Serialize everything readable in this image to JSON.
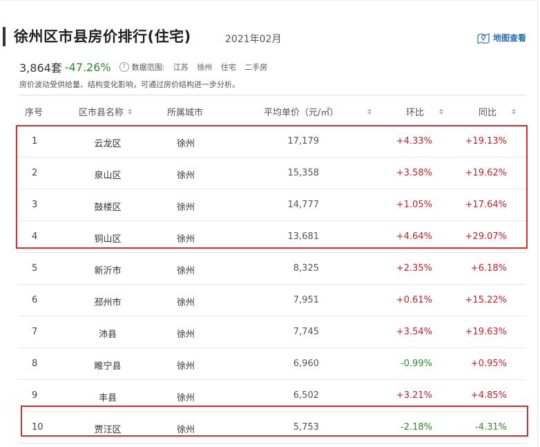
{
  "header": {
    "title": "徐州区市县房价排行(住宅)",
    "date": "2021年02月",
    "map_link": "地图查看"
  },
  "summary": {
    "count": "3,864套",
    "change": "-47.26%",
    "scope_label": "数据范围:",
    "scope_items": [
      "江苏",
      "徐州",
      "住宅",
      "二手房"
    ],
    "note": "房价波动受供给量、结构变化影响，可通过房价结构进一步分析。"
  },
  "table": {
    "columns": [
      "序号",
      "区市县名称",
      "所属城市",
      "平均单价（元/㎡）",
      "环比",
      "同比"
    ],
    "rows": [
      {
        "idx": "1",
        "name": "云龙区",
        "city": "徐州",
        "price": "17,179",
        "mom": "+4.33%",
        "yoy": "+19.13%"
      },
      {
        "idx": "2",
        "name": "泉山区",
        "city": "徐州",
        "price": "15,358",
        "mom": "+3.58%",
        "yoy": "+19.62%"
      },
      {
        "idx": "3",
        "name": "鼓楼区",
        "city": "徐州",
        "price": "14,777",
        "mom": "+1.05%",
        "yoy": "+17.64%"
      },
      {
        "idx": "4",
        "name": "铜山区",
        "city": "徐州",
        "price": "13,681",
        "mom": "+4.64%",
        "yoy": "+29.07%"
      },
      {
        "idx": "5",
        "name": "新沂市",
        "city": "徐州",
        "price": "8,325",
        "mom": "+2.35%",
        "yoy": "+6.18%"
      },
      {
        "idx": "6",
        "name": "邳州市",
        "city": "徐州",
        "price": "7,951",
        "mom": "+0.61%",
        "yoy": "+15.22%"
      },
      {
        "idx": "7",
        "name": "沛县",
        "city": "徐州",
        "price": "7,745",
        "mom": "+3.54%",
        "yoy": "+19.63%"
      },
      {
        "idx": "8",
        "name": "睢宁县",
        "city": "徐州",
        "price": "6,960",
        "mom": "-0.99%",
        "yoy": "+0.95%"
      },
      {
        "idx": "9",
        "name": "丰县",
        "city": "徐州",
        "price": "6,502",
        "mom": "+3.21%",
        "yoy": "+4.85%"
      },
      {
        "idx": "10",
        "name": "贾汪区",
        "city": "徐州",
        "price": "5,753",
        "mom": "-2.18%",
        "yoy": "-4.31%"
      }
    ]
  },
  "colors": {
    "positive": "#c41f2e",
    "negative": "#2e8b2e",
    "highlight_border": "#e0262c",
    "link": "#2a6fb3"
  }
}
